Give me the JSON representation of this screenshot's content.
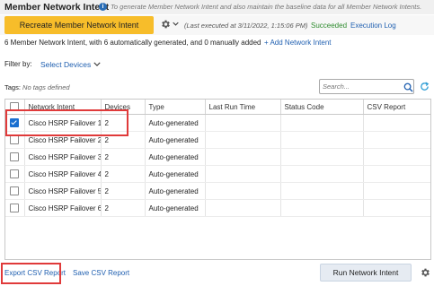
{
  "header": {
    "title": "Member Network Intent",
    "subtitle": "To generate Member Network Intent and also maintain the baseline data for all Member Network Intents."
  },
  "toolbar": {
    "recreate_button": "Recreate Member Network Intent",
    "last_executed": "(Last executed at 3/11/2022, 1:15:06 PM)",
    "status": "Succeeded",
    "execution_log": "Execution Log"
  },
  "summary": {
    "text": "6 Member Network Intent, with 6 automatically generated, and 0 manually added",
    "add_link": "+ Add Network Intent"
  },
  "filter": {
    "label": "Filter by:",
    "value": "Select Devices"
  },
  "tags": {
    "label": "Tags:",
    "value": "No tags defined"
  },
  "search": {
    "placeholder": "Search..."
  },
  "table": {
    "columns": [
      "Network Intent",
      "Devices",
      "Type",
      "Last Run Time",
      "Status Code",
      "CSV Report"
    ],
    "rows": [
      {
        "checked": true,
        "name": "Cisco HSRP Failover 1",
        "devices": "2",
        "type": "Auto-generated",
        "last_run": "",
        "status": "",
        "csv": ""
      },
      {
        "checked": false,
        "name": "Cisco HSRP Failover 2",
        "devices": "2",
        "type": "Auto-generated",
        "last_run": "",
        "status": "",
        "csv": ""
      },
      {
        "checked": false,
        "name": "Cisco HSRP Failover 3",
        "devices": "2",
        "type": "Auto-generated",
        "last_run": "",
        "status": "",
        "csv": ""
      },
      {
        "checked": false,
        "name": "Cisco HSRP Failover 4",
        "devices": "2",
        "type": "Auto-generated",
        "last_run": "",
        "status": "",
        "csv": ""
      },
      {
        "checked": false,
        "name": "Cisco HSRP Failover 5",
        "devices": "2",
        "type": "Auto-generated",
        "last_run": "",
        "status": "",
        "csv": ""
      },
      {
        "checked": false,
        "name": "Cisco HSRP Failover 6",
        "devices": "2",
        "type": "Auto-generated",
        "last_run": "",
        "status": "",
        "csv": ""
      }
    ]
  },
  "footer": {
    "export_csv": "Export CSV Report",
    "save_csv": "Save CSV Report",
    "run_button": "Run Network Intent"
  },
  "colors": {
    "accent_button": "#f7bd2a",
    "link": "#1f5fb0",
    "success": "#2e8b2e",
    "highlight": "#e03a3a",
    "checkbox": "#1a6fd0"
  }
}
